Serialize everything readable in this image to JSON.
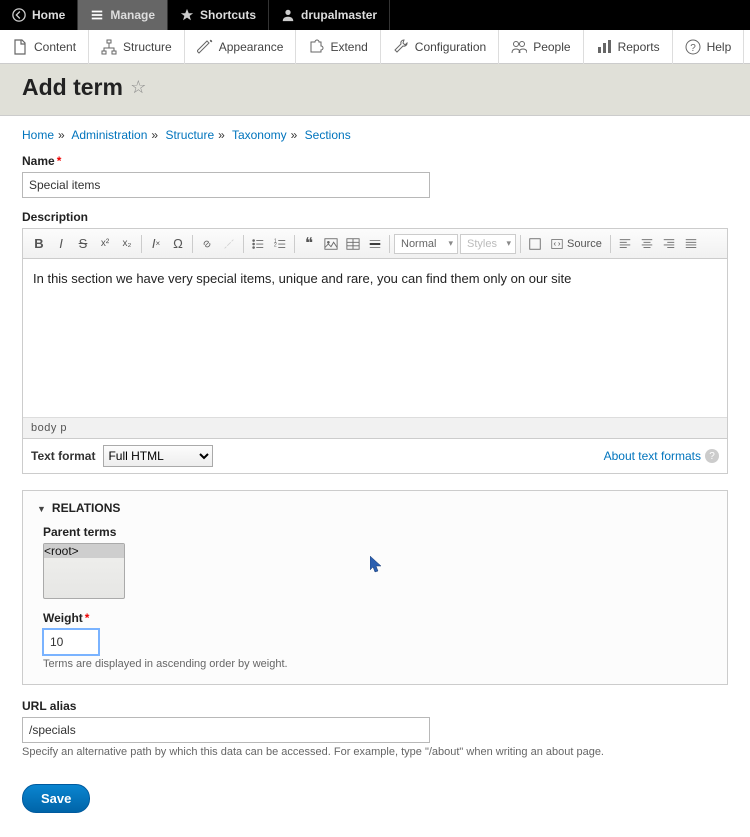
{
  "topbar": {
    "home": "Home",
    "manage": "Manage",
    "shortcuts": "Shortcuts",
    "user": "drupalmaster"
  },
  "admin_menu": {
    "content": "Content",
    "structure": "Structure",
    "appearance": "Appearance",
    "extend": "Extend",
    "configuration": "Configuration",
    "people": "People",
    "reports": "Reports",
    "help": "Help"
  },
  "page_title": "Add term",
  "breadcrumb": {
    "home": "Home",
    "administration": "Administration",
    "structure": "Structure",
    "taxonomy": "Taxonomy",
    "sections": "Sections"
  },
  "labels": {
    "name": "Name",
    "description": "Description",
    "text_format": "Text format",
    "about_text_formats": "About text formats",
    "relations": "RELATIONS",
    "parent_terms": "Parent terms",
    "weight": "Weight",
    "url_alias": "URL alias",
    "save": "Save"
  },
  "fields": {
    "name_value": "Special items",
    "description_value": "In this section we have very special items, unique and rare, you can find them only on our site",
    "format_selected": "Full HTML",
    "parent_root": "<root>",
    "weight_value": "10",
    "url_alias_value": "/specials"
  },
  "ckeditor": {
    "format_dropdown": "Normal",
    "styles_dropdown": "Styles",
    "source": "Source",
    "path": "body  p"
  },
  "help": {
    "weight": "Terms are displayed in ascending order by weight.",
    "url_alias": "Specify an alternative path by which this data can be accessed. For example, type \"/about\" when writing an about page."
  }
}
